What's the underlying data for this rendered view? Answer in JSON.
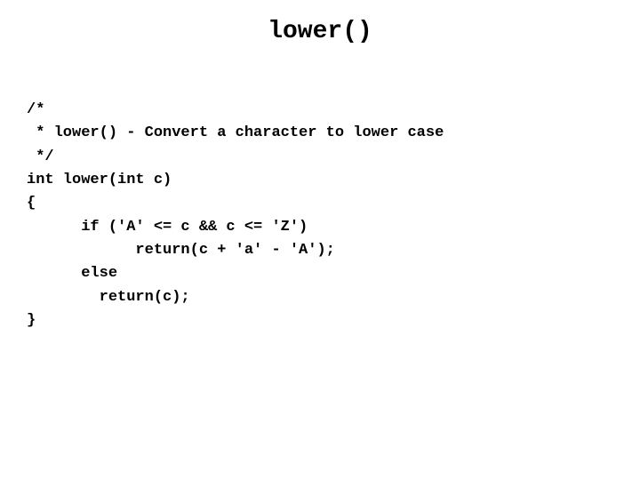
{
  "title": "lower()",
  "code": {
    "line1": "/*",
    "line2": " * lower() - Convert a character to lower case",
    "line3": " */",
    "line4": "int lower(int c)",
    "line5": "{",
    "line6": "      if ('A' <= c && c <= 'Z')",
    "line7": "            return(c + 'a' - 'A');",
    "line8": "      else",
    "line9": "        return(c);",
    "line10": "}"
  }
}
